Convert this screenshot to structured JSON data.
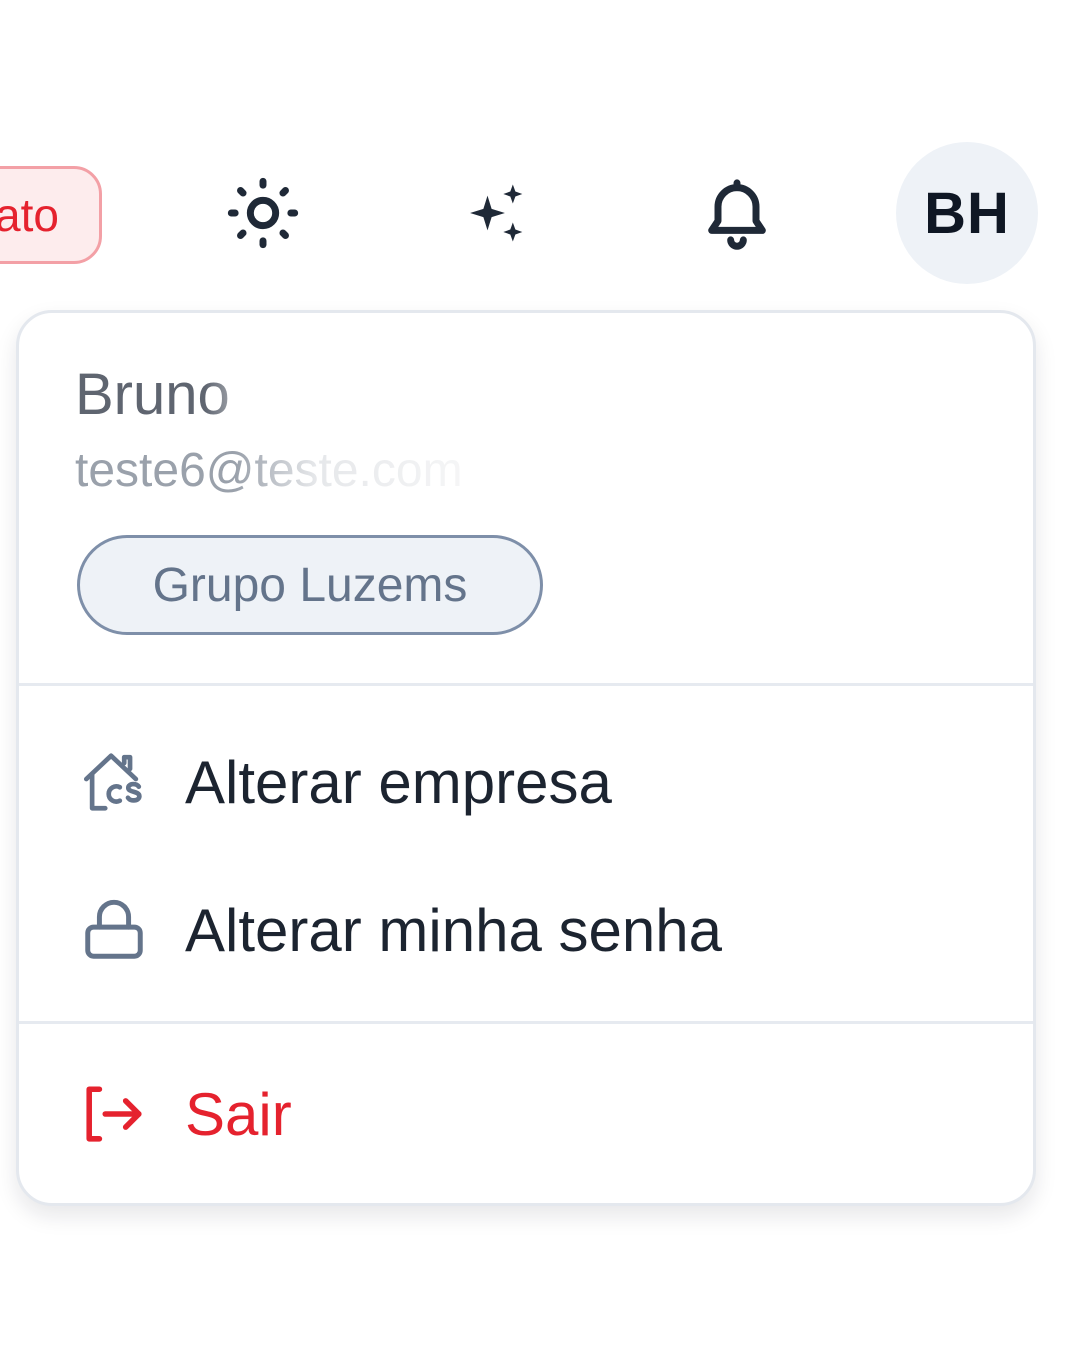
{
  "topbar": {
    "status_badge": "ato",
    "icons": {
      "theme": "sun-icon",
      "ai": "sparkles-icon",
      "notifications": "bell-icon"
    },
    "avatar_initials": "BH"
  },
  "user_menu": {
    "name": "Bruno",
    "email": "teste6@teste.com",
    "company_badge": "Grupo Luzems",
    "items": [
      {
        "label": "Alterar empresa",
        "icon": "company-switch-icon"
      },
      {
        "label": "Alterar minha senha",
        "icon": "lock-icon"
      },
      {
        "label": "Sair",
        "icon": "logout-icon"
      }
    ]
  },
  "colors": {
    "danger": "#e5222e",
    "icon_slate": "#64748b",
    "badge_border": "#7e8fa9"
  }
}
